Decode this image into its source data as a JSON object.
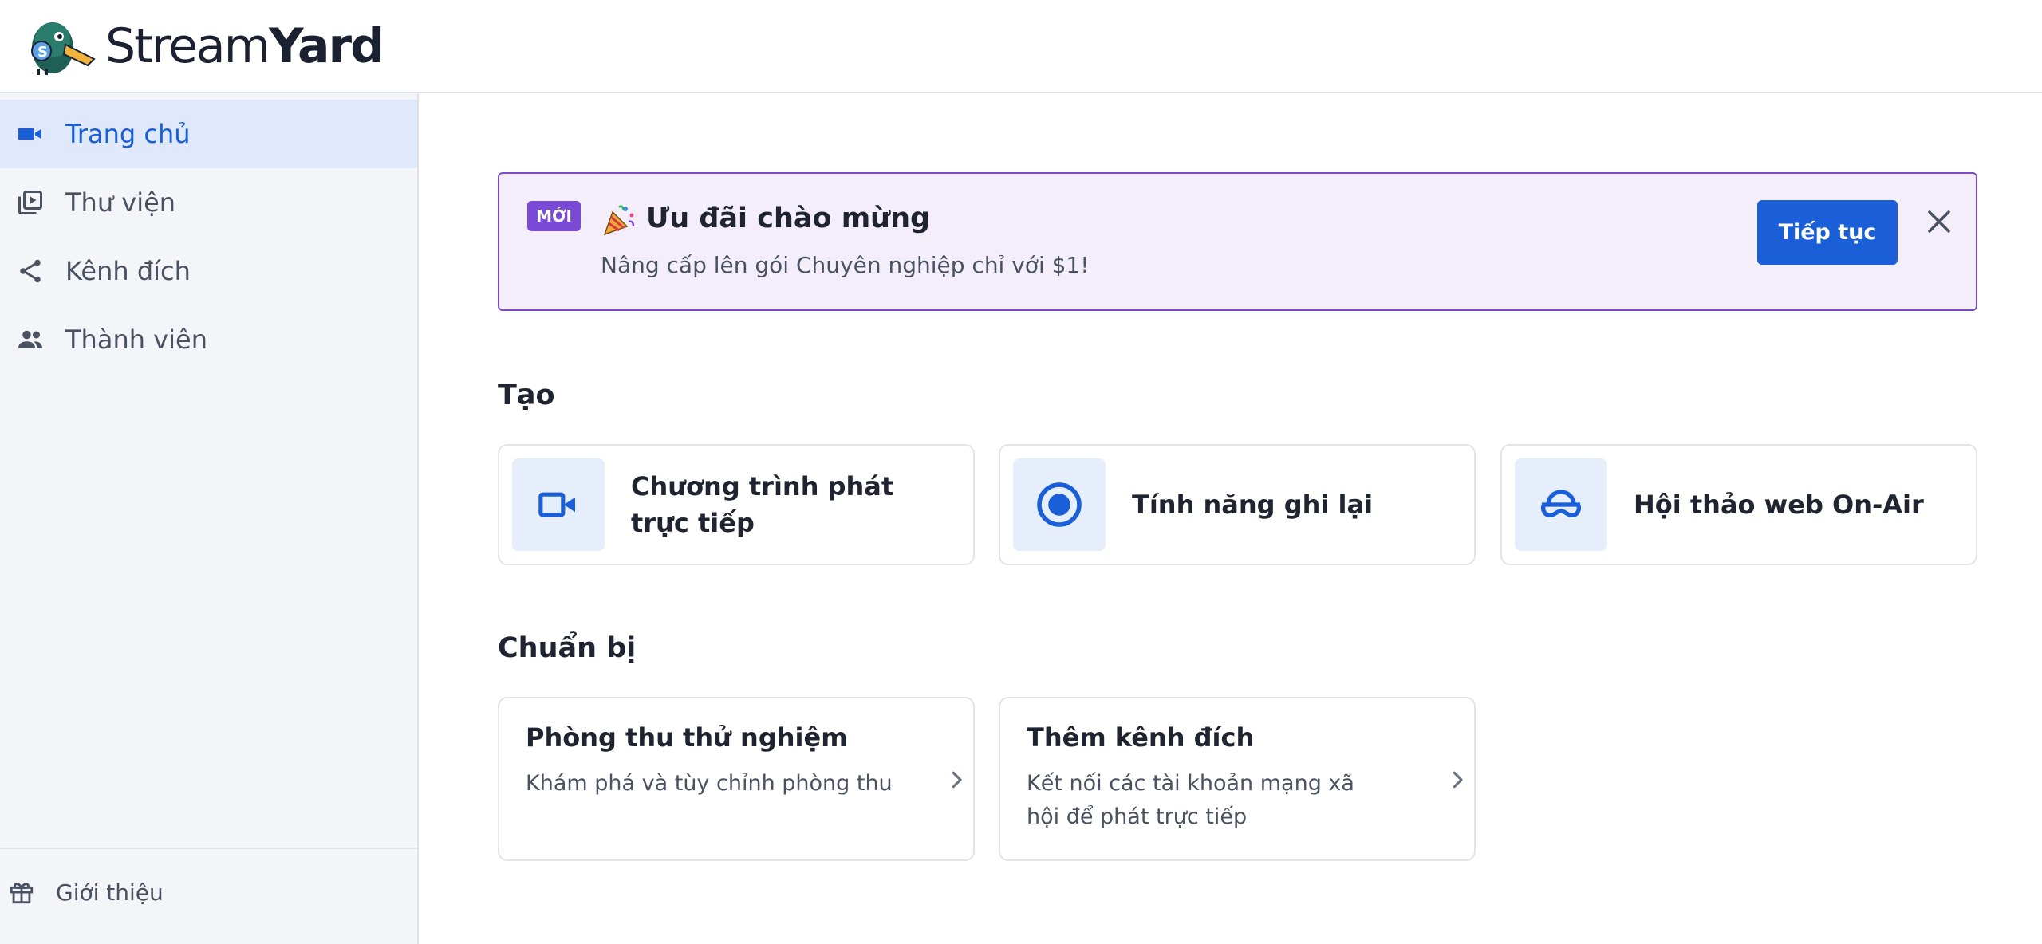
{
  "brand": {
    "name_light": "Stream",
    "name_bold": "Yard"
  },
  "sidebar": {
    "items": [
      {
        "label": "Trang chủ",
        "icon": "video-camera-icon",
        "active": true
      },
      {
        "label": "Thư viện",
        "icon": "library-icon",
        "active": false
      },
      {
        "label": "Kênh đích",
        "icon": "share-icon",
        "active": false
      },
      {
        "label": "Thành viên",
        "icon": "people-icon",
        "active": false
      }
    ],
    "footer": {
      "label": "Giới thiệu",
      "icon": "gift-icon"
    }
  },
  "banner": {
    "badge": "MỚI",
    "title": "Ưu đãi chào mừng",
    "subtitle": "Nâng cấp lên gói Chuyên nghiệp chỉ với $1!",
    "button": "Tiếp tục",
    "icon": "party-popper-icon"
  },
  "create": {
    "title": "Tạo",
    "cards": [
      {
        "label": "Chương trình phát trực tiếp",
        "icon": "video-camera-icon"
      },
      {
        "label": "Tính năng ghi lại",
        "icon": "record-icon"
      },
      {
        "label": "Hội thảo web On-Air",
        "icon": "on-air-icon"
      }
    ]
  },
  "prepare": {
    "title": "Chuẩn bị",
    "cards": [
      {
        "title": "Phòng thu thử nghiệm",
        "subtitle": "Khám phá và tùy chỉnh phòng thu"
      },
      {
        "title": "Thêm kênh đích",
        "subtitle": "Kết nối các tài khoản mạng xã hội để phát trực tiếp"
      }
    ]
  },
  "colors": {
    "accent": "#1a5fd8",
    "badge": "#7a4ad6",
    "banner_bg": "#f3eefa",
    "sidebar_bg": "#f4f5f8"
  }
}
